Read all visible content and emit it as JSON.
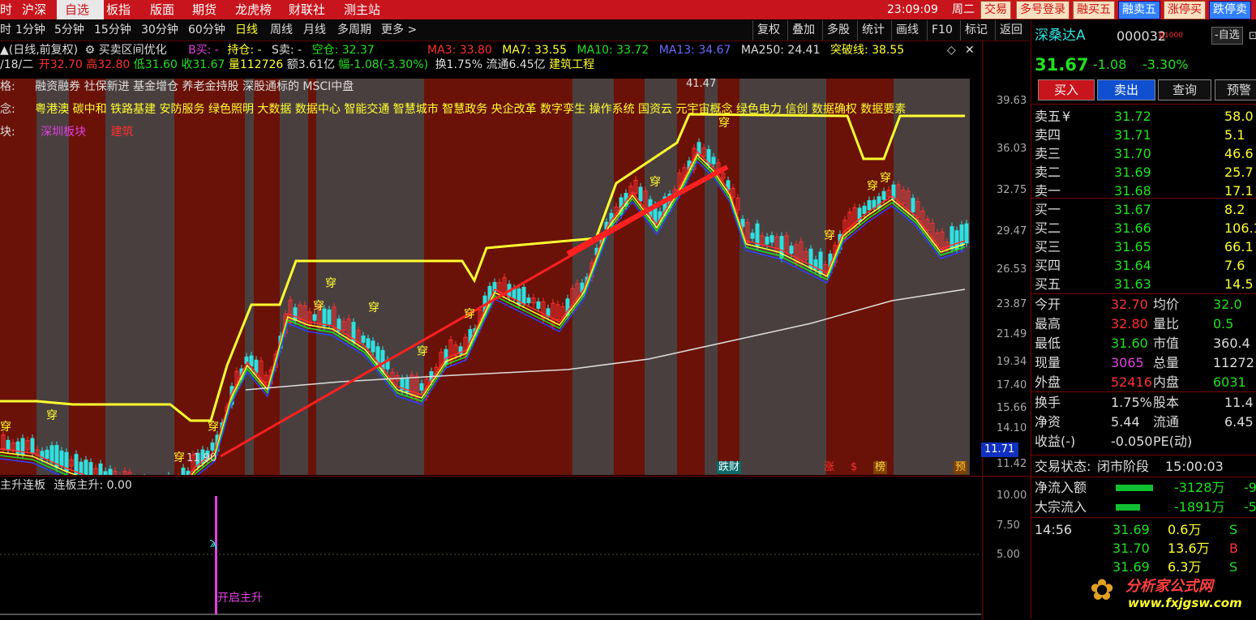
{
  "menu": {
    "items": [
      "时",
      "沪深",
      "自选",
      "板指",
      "版面",
      "期货",
      "龙虎榜",
      "财联社",
      "测主站"
    ],
    "active_index": 2,
    "clock": "23:09:09",
    "weekday": "周二",
    "quick_buttons": [
      "交易",
      "多号登录",
      "融买五",
      "融卖五",
      "涨停买",
      "跌停卖"
    ]
  },
  "toolbar": {
    "periods": [
      "时",
      "1分钟",
      "5分钟",
      "15分钟",
      "30分钟",
      "60分钟",
      "日线",
      "周线",
      "月线",
      "多周期",
      "更多 >"
    ],
    "active_period": "日线",
    "tools": [
      "复权",
      "叠加",
      "多股",
      "统计",
      "画线",
      "F10",
      "标记",
      "返回"
    ]
  },
  "chart_header": {
    "mode": "▲(日线,前复权)",
    "indicator": "买卖区间优化",
    "b_buy": "B买: -",
    "hold": "持仓: -",
    "s_sell": "S卖: -",
    "empty_pos": "空仓: 32.37",
    "ma3": "MA3: 33.80",
    "ma7": "MA7: 33.55",
    "ma10": "MA10: 33.72",
    "ma13": "MA13: 34.67",
    "ma250": "MA250: 24.41",
    "breakout": "突破线: 38.55"
  },
  "quote_line": {
    "date": "/18/二",
    "open": "开32.70",
    "high": "高32.80",
    "low": "低31.60",
    "close": "收31.67",
    "volume": "量112726",
    "amount": "额3.61亿",
    "change": "幅-1.08(-3.30%)",
    "turnover": "换1.75%",
    "float_cap": "流通6.45亿",
    "sector": "建筑工程"
  },
  "tags": {
    "style_label": "格:",
    "style_text": "融资融券 社保新进 基金增仓 养老金持股 深股通标的 MSCI中盘",
    "concept_label": "念:",
    "concept_text": "粤港澳 碳中和 铁路基建 安防服务 绿色照明 大数据 数据中心 智能交通 智慧城市 智慧政务 央企改革 数字孪生 操作系统 国资云 元宇宙概念 绿色电力 信创 数据确权 数据要素",
    "board_label": "块:",
    "board_text": "深圳板块",
    "board_text2": "建筑"
  },
  "chart_markers": {
    "high_label": "41.47",
    "low_label": "11.90",
    "price_tag": "11.71",
    "pierce": "穿",
    "event_tags": [
      "跌财",
      "涨",
      "$",
      "榜",
      "预"
    ]
  },
  "price_axis": [
    "39.63",
    "36.03",
    "32.75",
    "29.47",
    "26.53",
    "23.87",
    "21.49",
    "19.34",
    "17.40",
    "15.66",
    "14.10",
    "11.42"
  ],
  "sub_chart": {
    "title": "主升连板",
    "value_text": "连板主升: 0.00",
    "axis": [
      "10.00",
      "7.50",
      "5.00"
    ],
    "signal_label": "开启主升"
  },
  "right_panel": {
    "stock_name": "深桑达A",
    "stock_code": "000032",
    "badge": "R",
    "badge2": "1000",
    "watch_btn": "-自选",
    "price": "31.67",
    "change": "-1.08",
    "change_pct": "-3.30%",
    "buttons": [
      "买入",
      "卖出",
      "查询",
      "预警"
    ],
    "asks": [
      {
        "label": "卖五",
        "sym": "¥",
        "price": "31.72",
        "vol": "58.0"
      },
      {
        "label": "卖四",
        "sym": "",
        "price": "31.71",
        "vol": "5.1"
      },
      {
        "label": "卖三",
        "sym": "",
        "price": "31.70",
        "vol": "46.6"
      },
      {
        "label": "卖二",
        "sym": "",
        "price": "31.69",
        "vol": "25.7"
      },
      {
        "label": "卖一",
        "sym": "",
        "price": "31.68",
        "vol": "17.1"
      }
    ],
    "bids": [
      {
        "label": "买一",
        "price": "31.67",
        "vol": "8.2"
      },
      {
        "label": "买二",
        "price": "31.66",
        "vol": "106.1"
      },
      {
        "label": "买三",
        "price": "31.65",
        "vol": "66.1"
      },
      {
        "label": "买四",
        "price": "31.64",
        "vol": "7.6"
      },
      {
        "label": "买五",
        "price": "31.63",
        "vol": "14.5"
      }
    ],
    "stats": [
      {
        "l1": "今开",
        "v1": "32.70",
        "l2": "均价",
        "v2": "32.0",
        "c1": "r",
        "c2": "g"
      },
      {
        "l1": "最高",
        "v1": "32.80",
        "l2": "量比",
        "v2": "0.5",
        "c1": "r",
        "c2": "g"
      },
      {
        "l1": "最低",
        "v1": "31.60",
        "l2": "市值",
        "v2": "360.4",
        "c1": "g",
        "c2": "w"
      },
      {
        "l1": "现量",
        "v1": "3065",
        "l2": "总量",
        "v2": "11272",
        "c1": "m",
        "c2": "w"
      },
      {
        "l1": "外盘",
        "v1": "52416",
        "l2": "内盘",
        "v2": "6031",
        "c1": "r",
        "c2": "g"
      }
    ],
    "stats2": [
      {
        "l1": "换手",
        "v1": "1.75%",
        "l2": "股本",
        "v2": "11.4"
      },
      {
        "l1": "净资",
        "v1": "5.44",
        "l2": "流通",
        "v2": "6.45"
      },
      {
        "l1": "收益(-)",
        "v1": "-0.050",
        "l2": "PE(动)",
        "v2": ""
      }
    ],
    "trade_status_label": "交易状态:",
    "trade_status": "闭市阶段",
    "trade_time": "15:00:03",
    "flows": [
      {
        "label": "净流入额",
        "value": "-3128万",
        "tail": "-9"
      },
      {
        "label": "大宗流入",
        "value": "-1891万",
        "tail": "-5"
      }
    ],
    "ticks_time": "14:56",
    "ticks": [
      {
        "price": "31.69",
        "vol": "0.6万",
        "side": "S"
      },
      {
        "price": "31.70",
        "vol": "13.6万",
        "side": "B"
      },
      {
        "price": "31.69",
        "vol": "6.3万",
        "side": "S"
      }
    ],
    "watermark_cn": "分析家公式网",
    "watermark_url": "www.fxjgsw.com"
  }
}
